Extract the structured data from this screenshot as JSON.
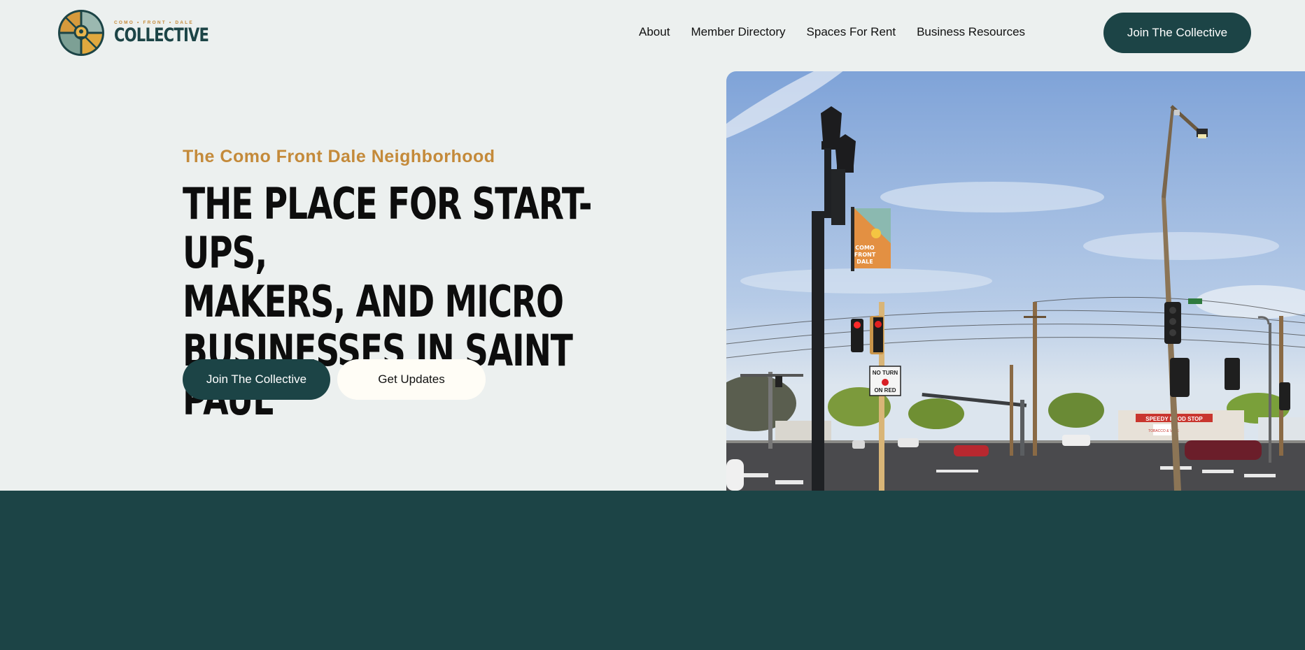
{
  "brand": {
    "small_text": "COMO • FRONT • DALE",
    "big_text": "COLLECTIVE",
    "colors": {
      "primary": "#1c4446",
      "accent": "#c48a3a",
      "background": "#ecf0ef",
      "light_button": "#fffdf6"
    }
  },
  "nav": {
    "items": [
      {
        "label": "About"
      },
      {
        "label": "Member Directory"
      },
      {
        "label": "Spaces For Rent"
      },
      {
        "label": "Business Resources"
      }
    ],
    "cta_label": "Join The Collective"
  },
  "hero": {
    "kicker": "The Como Front Dale Neighborhood",
    "headline_lines": [
      "THE PLACE FOR START-UPS,",
      "MAKERS, AND MICRO",
      "BUSINESSES IN SAINT PAUL"
    ],
    "primary_cta": "Join The Collective",
    "secondary_cta": "Get Updates",
    "photo": {
      "banner_lines": [
        "COMO",
        "FRONT",
        "DALE"
      ],
      "sign_lines": [
        "NO TURN",
        "ON RED"
      ],
      "store_sign": "SPEEDY FOOD STOP",
      "store_sub": "TOBACCO & VAPE"
    }
  }
}
